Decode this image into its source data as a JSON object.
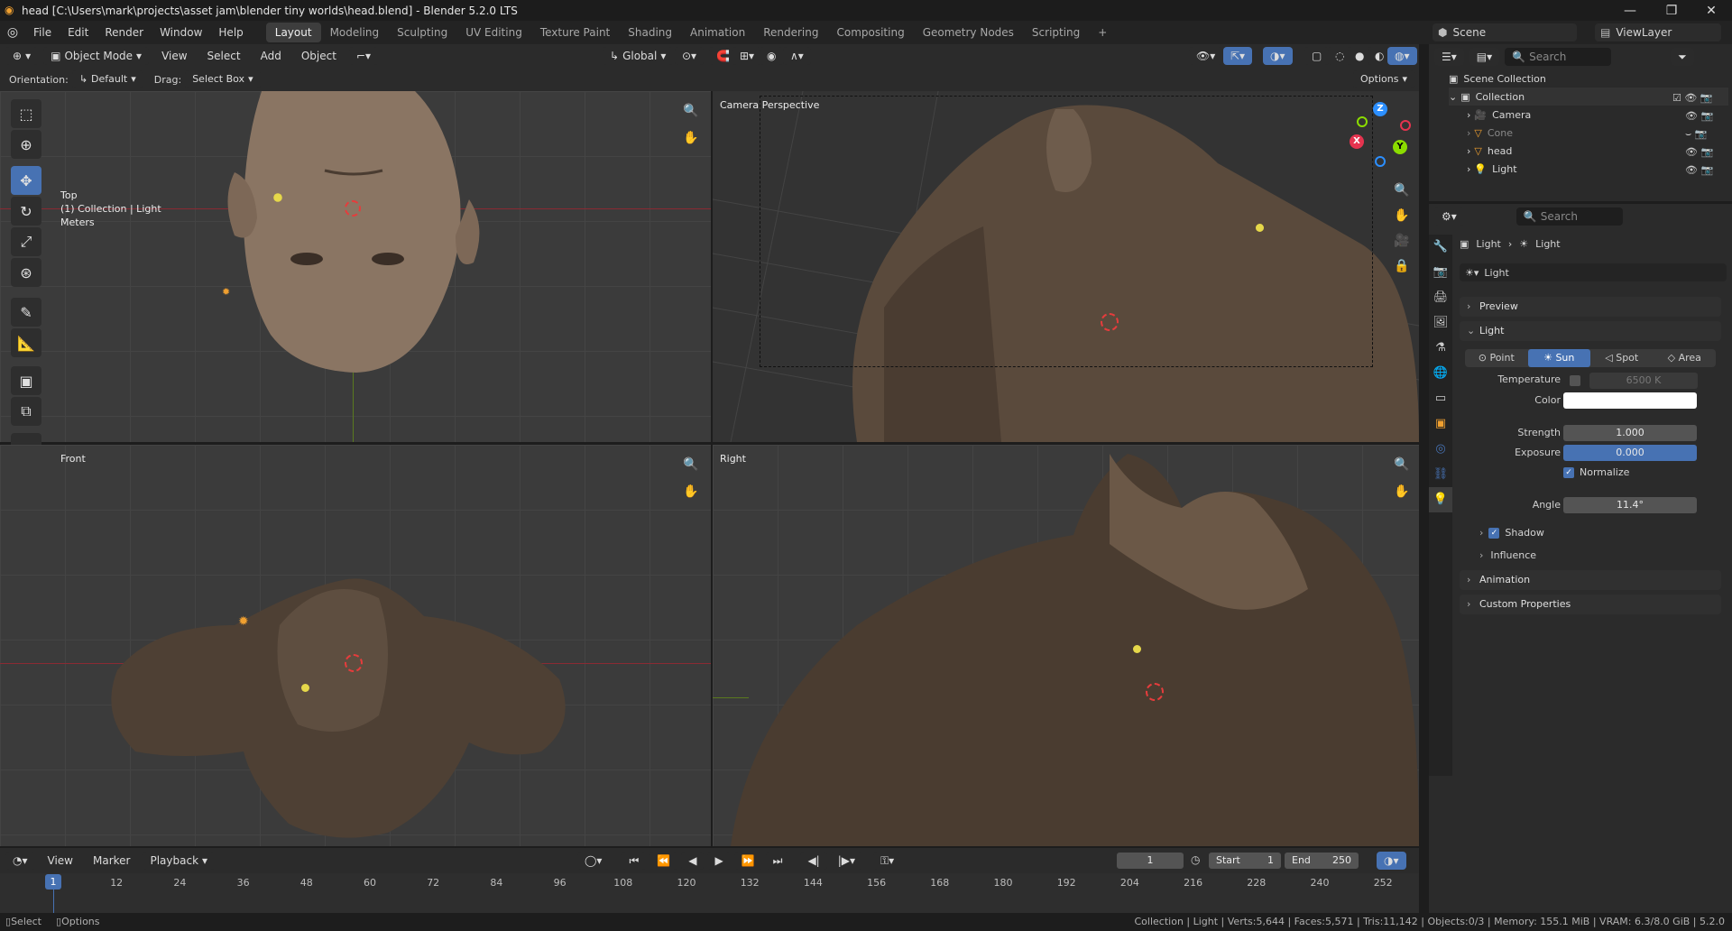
{
  "titlebar": {
    "title": "head [C:\\Users\\mark\\projects\\asset jam\\blender tiny worlds\\head.blend] - Blender 5.2.0 LTS",
    "minimize": "—",
    "maximize": "❐",
    "close": "✕"
  },
  "menu": [
    "File",
    "Edit",
    "Render",
    "Window",
    "Help"
  ],
  "workspaces": [
    "Layout",
    "Modeling",
    "Sculpting",
    "UV Editing",
    "Texture Paint",
    "Shading",
    "Animation",
    "Rendering",
    "Compositing",
    "Geometry Nodes",
    "Scripting"
  ],
  "workspace_add": "+",
  "scene": {
    "name": "Scene",
    "view_layer": "ViewLayer"
  },
  "viewport_header": {
    "mode": "Object Mode",
    "menus": [
      "View",
      "Select",
      "Add",
      "Object"
    ],
    "transform_orientation": "Global"
  },
  "tool_settings": {
    "orientation_label": "Orientation:",
    "orientation_value": "Default",
    "drag_label": "Drag:",
    "drag_value": "Select Box",
    "options": "Options"
  },
  "viewports": {
    "top": {
      "line1": "Top",
      "line2": "(1) Collection | Light",
      "line3": "Meters"
    },
    "camera": {
      "label": "Camera Perspective"
    },
    "front": {
      "label": "Front"
    },
    "right": {
      "label": "Right"
    }
  },
  "gizmo": {
    "x": "X",
    "y": "Y",
    "z": "Z"
  },
  "outliner": {
    "search_placeholder": "Search",
    "scene_collection": "Scene Collection",
    "collection": "Collection",
    "items": [
      "Camera",
      "Cone",
      "head",
      "Light"
    ]
  },
  "properties": {
    "search_placeholder": "Search",
    "breadcrumb_object": "Light",
    "breadcrumb_data": "Light",
    "datablock_name": "Light",
    "panels": {
      "preview": "Preview",
      "light": "Light",
      "shadow": "Shadow",
      "influence": "Influence",
      "animation": "Animation",
      "custom_properties": "Custom Properties"
    },
    "light_types": [
      "Point",
      "Sun",
      "Spot",
      "Area"
    ],
    "active_type": "Sun",
    "temperature_label": "Temperature",
    "temperature_value": "6500 K",
    "color_label": "Color",
    "color_value": "#ffffff",
    "strength_label": "Strength",
    "strength_value": "1.000",
    "exposure_label": "Exposure",
    "exposure_value": "0.000",
    "normalize_label": "Normalize",
    "angle_label": "Angle",
    "angle_value": "11.4°"
  },
  "timeline": {
    "menus": [
      "View",
      "Marker"
    ],
    "playback": "Playback",
    "current_frame": "1",
    "start_label": "Start",
    "start_value": "1",
    "end_label": "End",
    "end_value": "250",
    "frame_labels": [
      "12",
      "24",
      "36",
      "48",
      "60",
      "72",
      "84",
      "96",
      "108",
      "120",
      "132",
      "144",
      "156",
      "168",
      "180",
      "192",
      "204",
      "216",
      "228",
      "240",
      "252"
    ],
    "playhead": "1"
  },
  "statusbar": {
    "left": [
      "Select",
      "Options"
    ],
    "right": "Collection | Light | Verts:5,644 | Faces:5,571 | Tris:11,142 | Objects:0/3 | Memory: 155.1 MiB | VRAM: 6.3/8.0 GiB | 5.2.0"
  },
  "colors": {
    "accent": "#4772b3",
    "axis_x": "#e5344f",
    "axis_y": "#8bdc00",
    "axis_z": "#2c8fff",
    "mesh": "#5a4a3c"
  }
}
